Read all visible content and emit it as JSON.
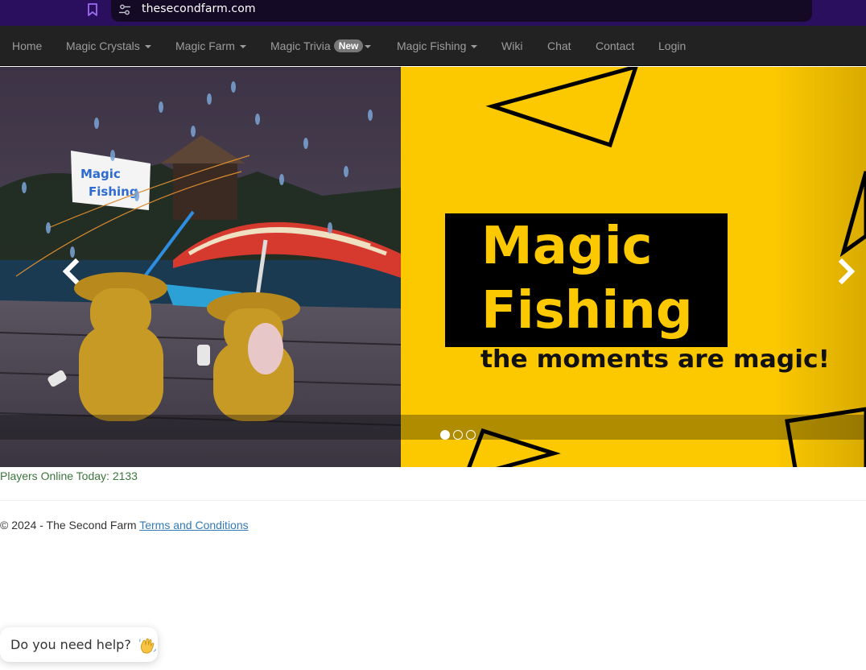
{
  "browser": {
    "url": "thesecondfarm.com",
    "bookmark_icon": "bookmark-icon",
    "site_settings_icon": "tune-icon"
  },
  "navbar": {
    "items": [
      {
        "label": "Home",
        "dropdown": false
      },
      {
        "label": "Magic Crystals",
        "dropdown": true
      },
      {
        "label": "Magic Farm",
        "dropdown": true
      },
      {
        "label": "Magic Trivia",
        "dropdown": true,
        "badge": "New"
      },
      {
        "label": "Magic Fishing",
        "dropdown": true
      },
      {
        "label": "Wiki",
        "dropdown": false
      },
      {
        "label": "Chat",
        "dropdown": false
      },
      {
        "label": "Contact",
        "dropdown": false
      },
      {
        "label": "Login",
        "dropdown": false
      }
    ]
  },
  "carousel": {
    "slide_banner": {
      "line1": "Magic",
      "line2": "Fishing",
      "tagline": "the moments are magic!",
      "sign_line1": "Magic",
      "sign_line2": "Fishing"
    },
    "indicator_count": 3,
    "active_index": 0,
    "prev_icon": "chevron-left-icon",
    "next_icon": "chevron-right-icon"
  },
  "players_online": "Players Online Today: 2133",
  "footer": {
    "copyright": "© 2024 - The Second Farm",
    "terms_link": "Terms and Conditions"
  },
  "help_bubble": {
    "text": "Do you need help?",
    "icon": "waving-hand-icon"
  },
  "colors": {
    "navbar_bg": "#222222",
    "nav_text": "#9d9d9d",
    "banner_yellow": "#fcc900",
    "players_text": "#3c763d",
    "link": "#337ab7",
    "browser_chrome": "#2a0f5e"
  }
}
